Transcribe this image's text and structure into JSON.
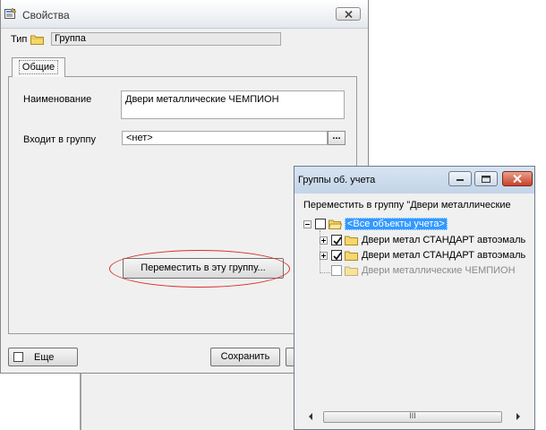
{
  "properties_window": {
    "title": "Свойства",
    "type_label": "Тип",
    "type_value": "Группа",
    "tab_label": "Общие",
    "name_label": "Наименование",
    "name_value": "Двери металлические ЧЕМПИОН",
    "group_label": "Входит в группу",
    "group_value": "<нет>",
    "dots_label": "...",
    "move_button_label": "Переместить в эту группу...",
    "more_label": "Еще",
    "save_label": "Сохранить"
  },
  "groups_window": {
    "title": "Группы об. учета",
    "move_text": "Переместить в группу \"Двери металлические",
    "tree": [
      {
        "label": "<Все объекты учета>",
        "checked": false,
        "selected": true
      },
      {
        "label": "Двери метал СТАНДАРТ автоэмаль",
        "checked": true
      },
      {
        "label": "Двери метал СТАНДАРТ автоэмаль",
        "checked": true
      },
      {
        "label": "Двери металлические ЧЕМПИОН",
        "checked": false,
        "disabled": true
      }
    ],
    "scroll_grip": "III"
  },
  "icons": {
    "folder_color": "#f5d76e",
    "highlight_color": "#d9302c",
    "selection_color": "#3399ff"
  }
}
